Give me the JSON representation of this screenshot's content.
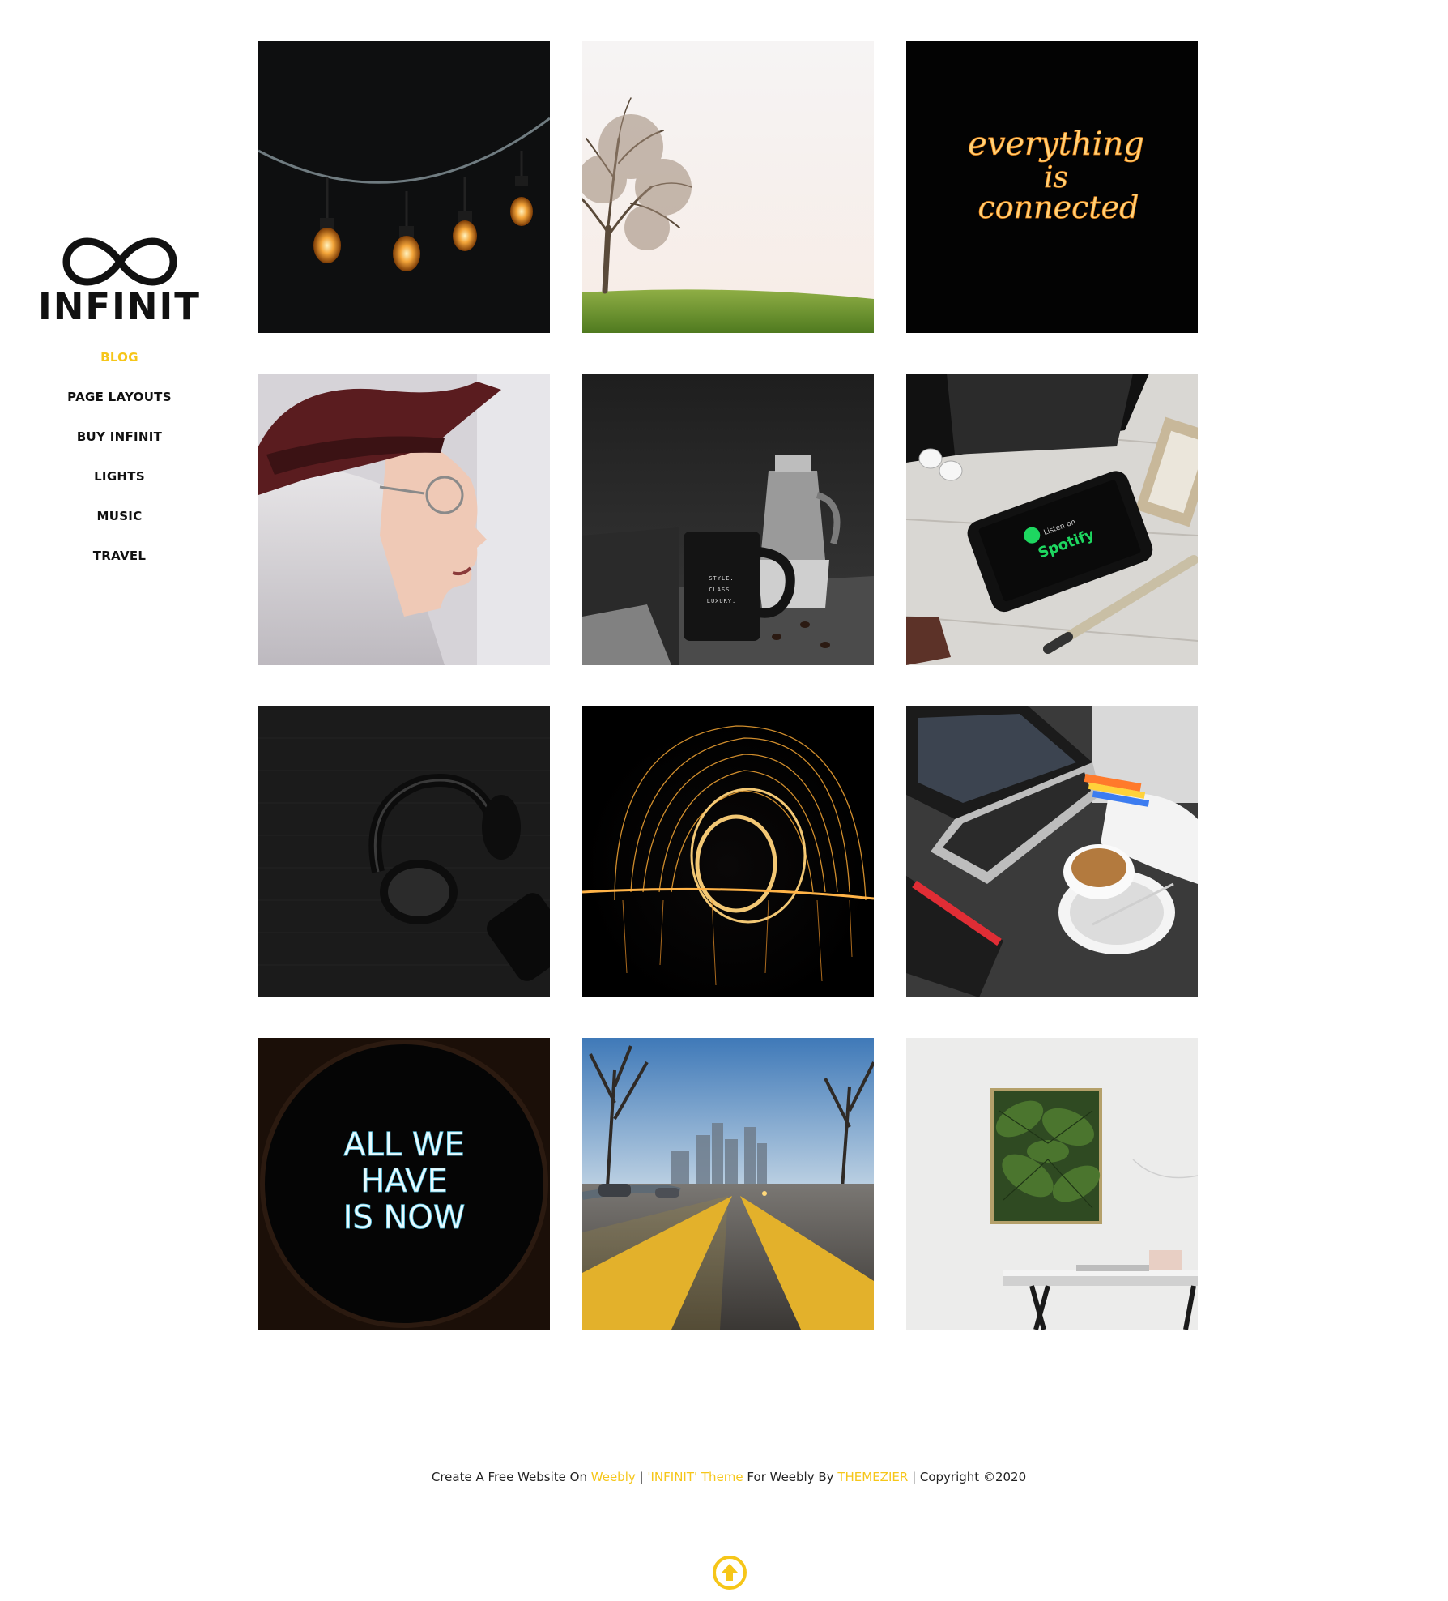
{
  "brand": {
    "name": "INFINIT",
    "accent_color": "#f6c619",
    "logo_icon": "infinity-icon"
  },
  "nav": {
    "items": [
      {
        "label": "BLOG",
        "active": true
      },
      {
        "label": "PAGE LAYOUTS",
        "active": false
      },
      {
        "label": "BUY INFINIT",
        "active": false
      },
      {
        "label": "LIGHTS",
        "active": false
      },
      {
        "label": "MUSIC",
        "active": false
      },
      {
        "label": "TRAVEL",
        "active": false
      }
    ]
  },
  "gallery": {
    "tiles": [
      {
        "name": "string-lights-photo"
      },
      {
        "name": "lone-tree-photo"
      },
      {
        "name": "neon-sign-photo",
        "text_line1": "everything",
        "text_line2": "is",
        "text_line3": "connected"
      },
      {
        "name": "woman-hat-photo"
      },
      {
        "name": "coffee-mug-photo",
        "mug_line1": "STYLE.",
        "mug_line2": "CLASS.",
        "mug_line3": "LUXURY."
      },
      {
        "name": "phone-spotify-photo",
        "screen_small": "Listen on",
        "screen_large": "Spotify"
      },
      {
        "name": "headphones-photo"
      },
      {
        "name": "steel-wool-photo"
      },
      {
        "name": "laptop-coffee-photo"
      },
      {
        "name": "neon-now-photo",
        "text_line1": "ALL WE",
        "text_line2": "HAVE",
        "text_line3": "IS NOW"
      },
      {
        "name": "city-road-photo"
      },
      {
        "name": "plant-frame-photo"
      }
    ]
  },
  "footer": {
    "prefix": "Create A Free Website On",
    "weebly_link": "Weebly",
    "sep1": "|",
    "theme_link": "'INFINIT' Theme",
    "middle": "For Weebly By",
    "author_link": "THEMEZIER",
    "copyright": "| Copyright ©2020"
  },
  "scroll_top": {
    "icon": "arrow-up-circle-icon"
  }
}
